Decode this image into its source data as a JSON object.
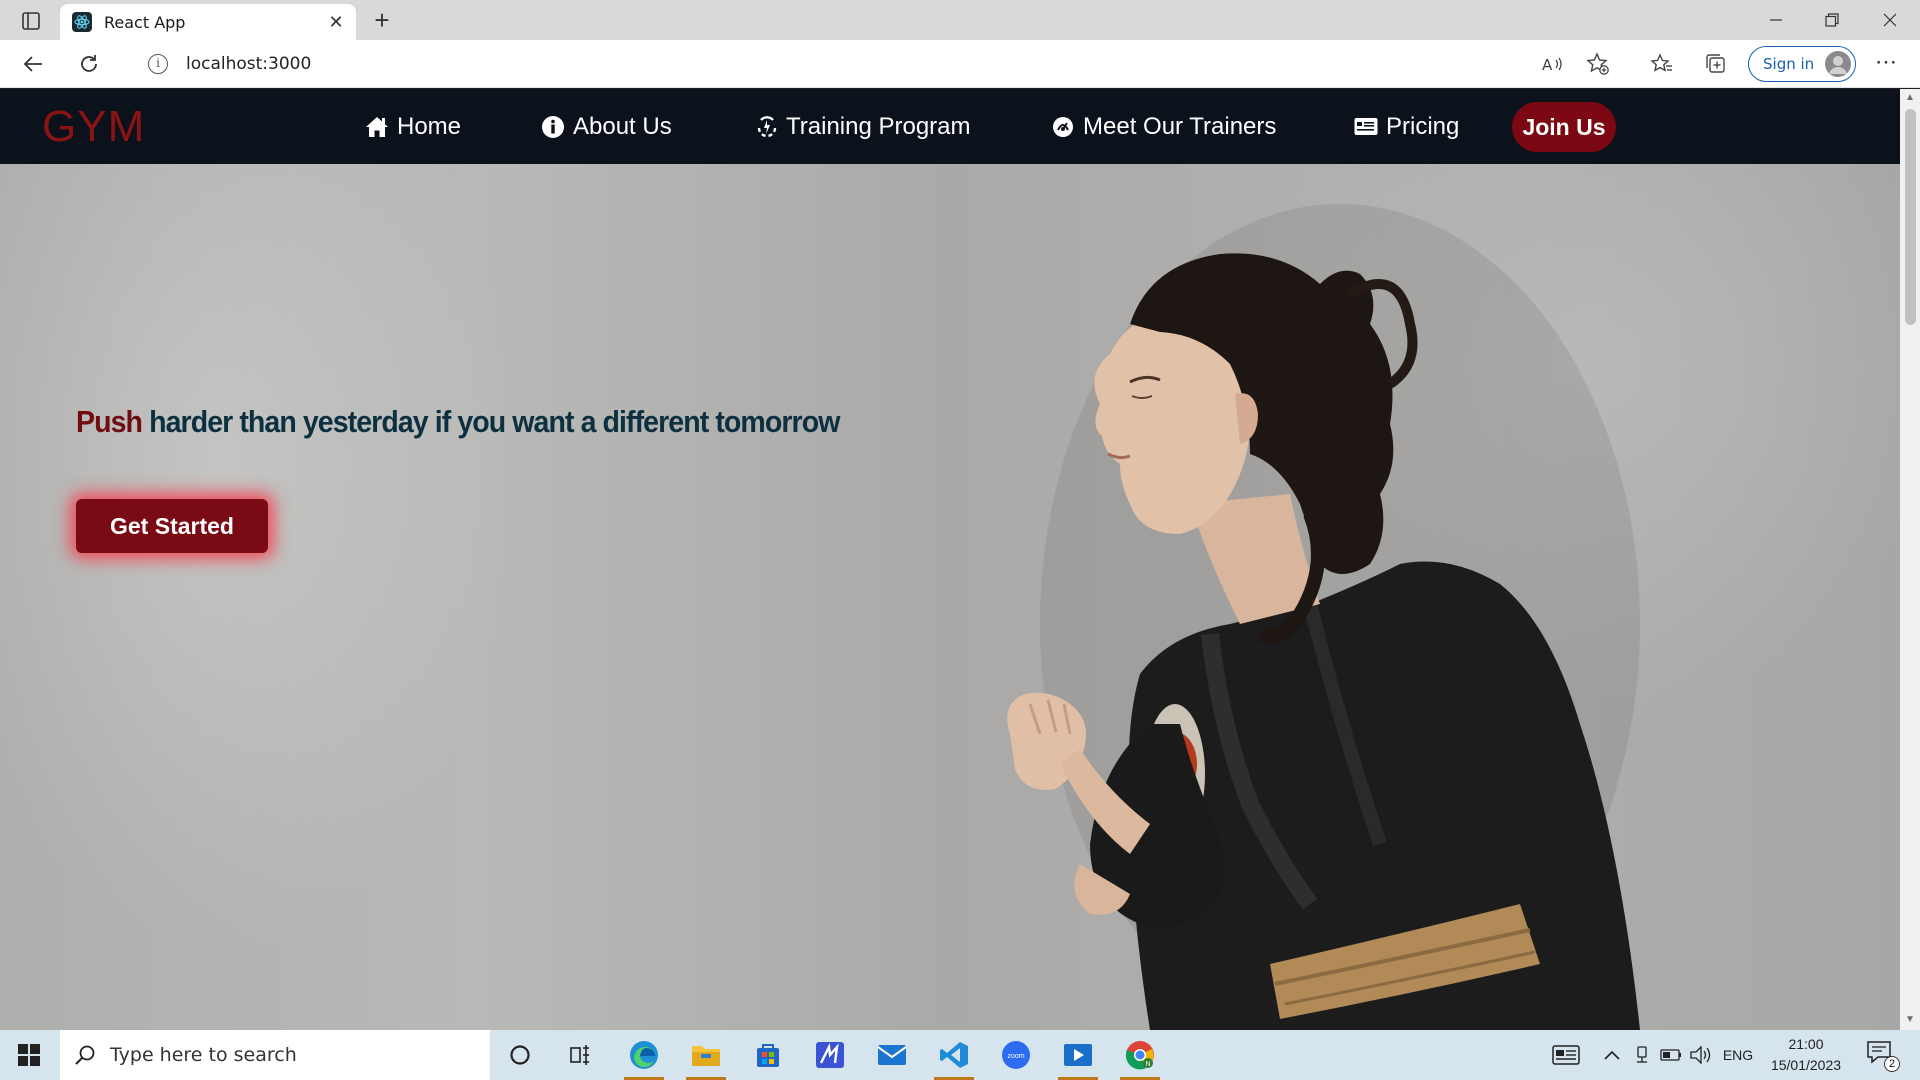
{
  "browser": {
    "tab_title": "React App",
    "url": "localhost:3000",
    "sign_in_label": "Sign in",
    "icons": [
      "tab-actions-icon",
      "react-favicon-icon",
      "close-icon",
      "plus-icon",
      "minimize-icon",
      "restore-icon",
      "window-close-icon",
      "back-arrow-icon",
      "refresh-icon",
      "info-icon",
      "read-aloud-icon",
      "add-favorite-icon",
      "favorites-icon",
      "collections-icon",
      "profile-avatar-icon",
      "more-icon"
    ]
  },
  "site": {
    "logo": "GYM",
    "nav": [
      {
        "label": "Home",
        "icon": "home-icon"
      },
      {
        "label": "About Us",
        "icon": "info-circle-icon"
      },
      {
        "label": "Training Program",
        "icon": "training-icon"
      },
      {
        "label": "Meet Our Trainers",
        "icon": "trainer-icon"
      },
      {
        "label": "Pricing",
        "icon": "pricing-card-icon"
      }
    ],
    "join_label": "Join Us",
    "colors": {
      "nav_bg": "#0b121c",
      "brand_red": "#8a1414",
      "button_red": "#7b0812",
      "tagline_dark": "#0d3040"
    }
  },
  "hero": {
    "tagline_accent": "Push",
    "tagline_rest": "harder than yesterday if you want a different tomorrow",
    "cta_label": "Get Started",
    "image_subject": "martial artist in black gi"
  },
  "taskbar": {
    "search_placeholder": "Type here to search",
    "apps": [
      "cortana-icon",
      "task-view-icon",
      "edge-icon",
      "file-explorer-icon",
      "microsoft-store-icon",
      "app-icon",
      "mail-icon",
      "vscode-icon",
      "zoom-icon",
      "media-player-icon",
      "chrome-icon"
    ],
    "tray_language": "ENG",
    "time": "21:00",
    "date": "15/01/2023",
    "notification_count": "2"
  }
}
